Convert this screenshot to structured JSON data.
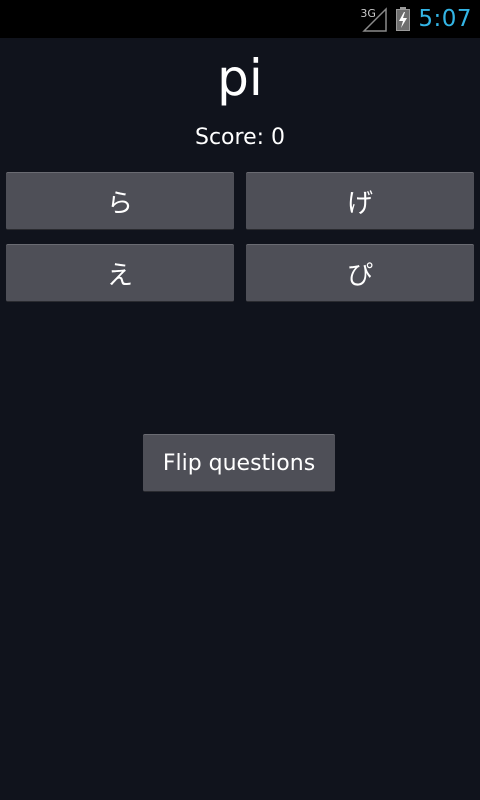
{
  "status_bar": {
    "network_label": "3G",
    "network_icon": "signal-icon",
    "battery_icon": "battery-charging-icon",
    "time": "5:07",
    "clock_color": "#33b5e5"
  },
  "quiz": {
    "question": "pi",
    "score_label": "Score: 0",
    "answers": [
      "ら",
      "げ",
      "え",
      "ぴ"
    ]
  },
  "actions": {
    "flip_label": "Flip questions"
  },
  "colors": {
    "background": "#10131c",
    "button": "#4e4f57"
  }
}
